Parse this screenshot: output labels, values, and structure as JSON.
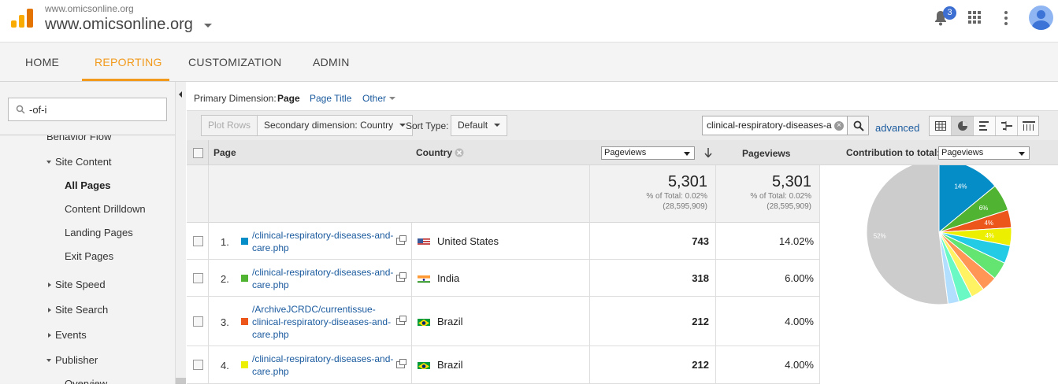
{
  "header": {
    "account_small": "www.omicsonline.org",
    "account_name": "www.omicsonline.org",
    "notification_count": "3"
  },
  "nav": {
    "tabs": [
      "HOME",
      "REPORTING",
      "CUSTOMIZATION",
      "ADMIN"
    ],
    "active": "REPORTING"
  },
  "sidebar": {
    "search_value": "-of-i",
    "items": [
      {
        "label": "Behavior Flow"
      },
      {
        "label": "Site Content"
      },
      {
        "label": "All Pages"
      },
      {
        "label": "Content Drilldown"
      },
      {
        "label": "Landing Pages"
      },
      {
        "label": "Exit Pages"
      },
      {
        "label": "Site Speed"
      },
      {
        "label": "Site Search"
      },
      {
        "label": "Events"
      },
      {
        "label": "Publisher"
      },
      {
        "label": "Overview"
      }
    ]
  },
  "primary_dimension": {
    "label": "Primary Dimension:",
    "options": [
      "Page",
      "Page Title",
      "Other"
    ],
    "selected": "Page"
  },
  "toolbar": {
    "plot_rows": "Plot Rows",
    "secondary_dimension": "Secondary dimension: Country",
    "sort_type_label": "Sort Type:",
    "sort_type_value": "Default",
    "filter_value": "clinical-respiratory-diseases-a",
    "advanced": "advanced"
  },
  "table": {
    "headers": {
      "page": "Page",
      "country": "Country",
      "metric_select": "Pageviews",
      "pageviews": "Pageviews",
      "contribution_label": "Contribution to total:",
      "contribution_select": "Pageviews"
    },
    "summary": {
      "total": "5,301",
      "pct_of_total": "% of Total: 0.02%",
      "overall": "(28,595,909)"
    },
    "rows": [
      {
        "index": "1.",
        "color": "#058dc7",
        "page": "/clinical-respiratory-diseases-and-care.php",
        "country": "United States",
        "pageviews": "743",
        "percent": "14.02%"
      },
      {
        "index": "2.",
        "color": "#50b432",
        "page": "/clinical-respiratory-diseases-and-care.php",
        "country": "India",
        "pageviews": "318",
        "percent": "6.00%"
      },
      {
        "index": "3.",
        "color": "#ed561b",
        "page": "/ArchiveJCRDC/currentissue-clinical-respiratory-diseases-and-care.php",
        "country": "Brazil",
        "pageviews": "212",
        "percent": "4.00%"
      },
      {
        "index": "4.",
        "color": "#edef00",
        "page": "/clinical-respiratory-diseases-and-care.php",
        "country": "Brazil",
        "pageviews": "212",
        "percent": "4.00%"
      }
    ]
  },
  "pie": {
    "slices": [
      {
        "percent": 14.02,
        "color": "#058dc7",
        "label": "14%"
      },
      {
        "percent": 6.0,
        "color": "#50b432",
        "label": "6%"
      },
      {
        "percent": 4.0,
        "color": "#ed561b",
        "label": "4%"
      },
      {
        "percent": 4.0,
        "color": "#edef00",
        "label": "4%"
      },
      {
        "percent": 4.0,
        "color": "#24cbe5",
        "label": ""
      },
      {
        "percent": 4.0,
        "color": "#64e572",
        "label": ""
      },
      {
        "percent": 3.5,
        "color": "#ff9655",
        "label": ""
      },
      {
        "percent": 3.0,
        "color": "#fff263",
        "label": ""
      },
      {
        "percent": 3.0,
        "color": "#6af9c4",
        "label": ""
      },
      {
        "percent": 2.5,
        "color": "#b2deff",
        "label": ""
      },
      {
        "percent": 51.98,
        "color": "#cccccc",
        "label": "52%"
      }
    ]
  }
}
